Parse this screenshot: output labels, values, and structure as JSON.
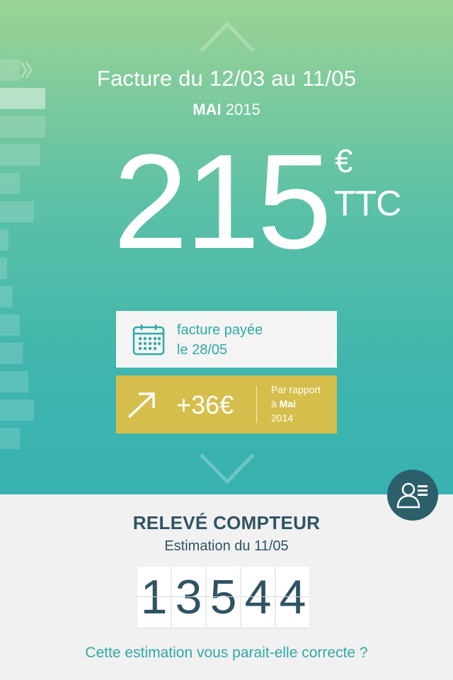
{
  "invoice": {
    "period": "Facture du 12/03 au 11/05",
    "month": "MAI",
    "year": "2015",
    "amount": "215",
    "currency": "€",
    "tax": "TTC"
  },
  "payment": {
    "line1": "facture payée",
    "line2": "le 28/05",
    "icon": "calendar-icon"
  },
  "comparison": {
    "value": "+36€",
    "ref_prefix": "Par rapport",
    "ref_a": "à",
    "ref_month": "Mai",
    "ref_year": "2014",
    "icon": "arrow-up-right-icon"
  },
  "meter": {
    "title": "RELEVÉ COMPTEUR",
    "subtitle": "Estimation du 11/05",
    "digits": [
      "1",
      "3",
      "5",
      "4",
      "4"
    ],
    "question": "Cette estimation vous parait-elle correcte ?"
  },
  "colors": {
    "accent": "#2fa9a8",
    "dark": "#2f5363",
    "yellow": "#d6be4c",
    "profile": "#2c5f6a"
  }
}
